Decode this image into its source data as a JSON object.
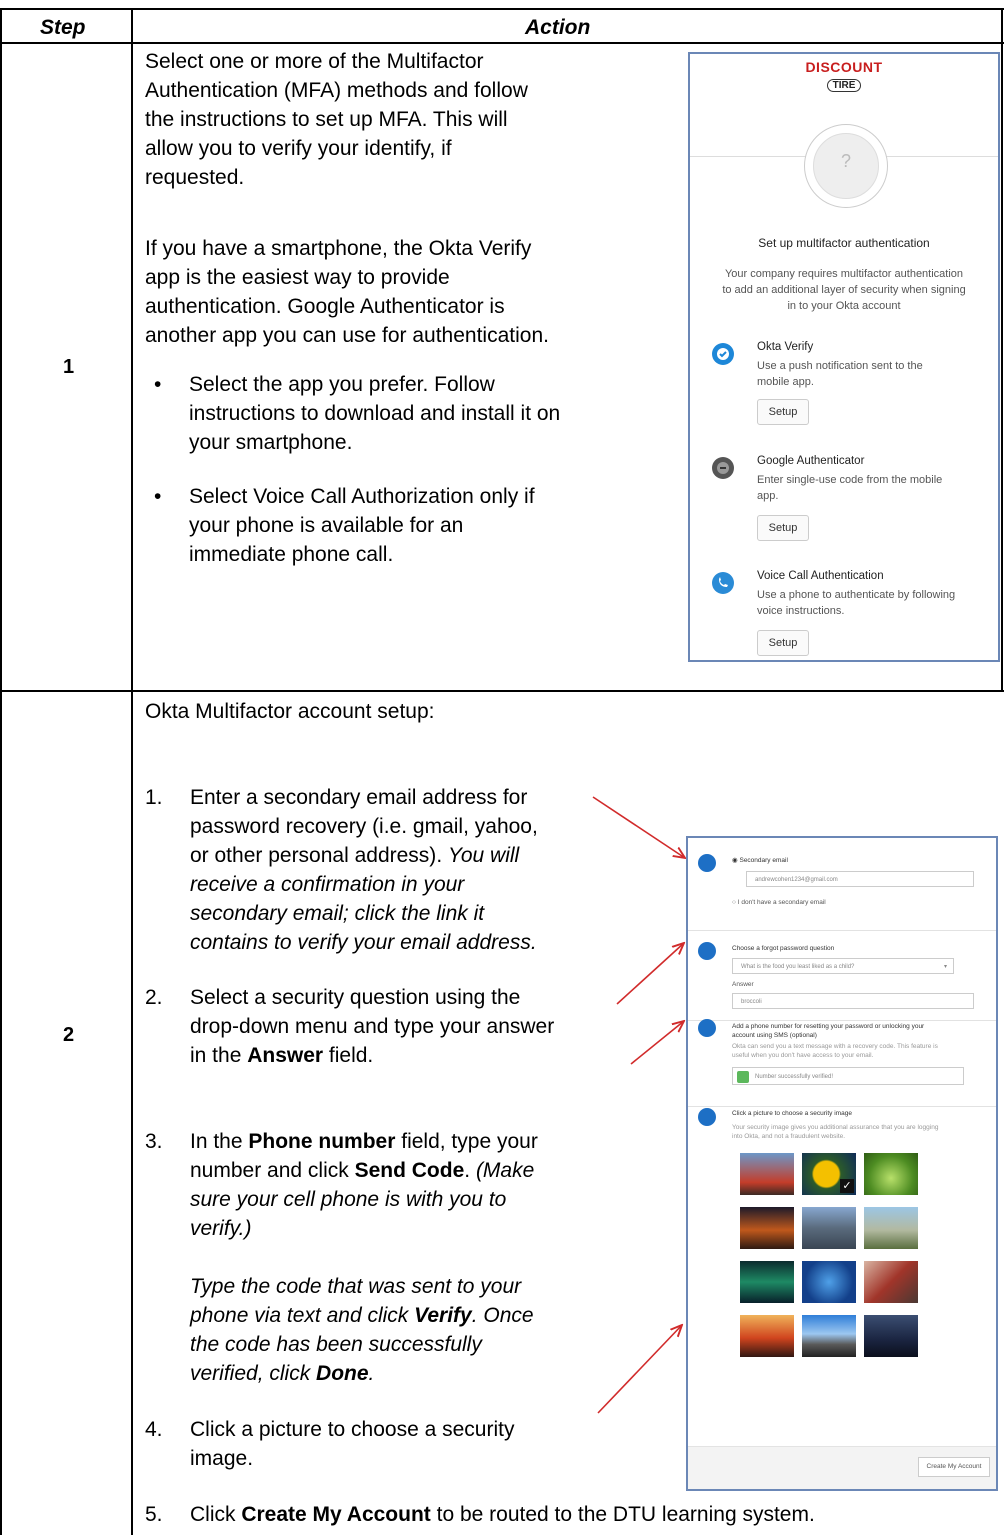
{
  "table": {
    "header": {
      "step": "Step",
      "action": "Action"
    },
    "rows": [
      {
        "step": "1",
        "para1": [
          "Select one or more of the Multifactor",
          "Authentication (MFA) methods and follow",
          "the instructions to set up MFA. This will",
          "allow you to verify your identify, if",
          "requested."
        ],
        "para2": [
          "If you have a smartphone, the Okta Verify",
          "app is the easiest way to provide",
          "authentication. Google Authenticator is",
          "another app you can use for authentication."
        ],
        "bullets": [
          [
            "Select the app you prefer. Follow",
            "instructions to download and install it on",
            "your smartphone."
          ],
          [
            "Select Voice Call Authorization only if",
            "your phone is available for an",
            "immediate phone call."
          ]
        ]
      },
      {
        "step": "2",
        "intro": "Okta Multifactor account setup:",
        "items": [
          {
            "num": "1.",
            "lines": [
              "Enter a secondary email address for",
              "password recovery (i.e. gmail, yahoo,",
              "or other personal address)"
            ],
            "tail": ". ",
            "italic_inline": "You will",
            "italic_lines": [
              "receive a confirmation in your",
              "secondary email; click the link it",
              "contains to verify your email address."
            ]
          },
          {
            "num": "2.",
            "lines": [
              "Select a security question using the",
              "drop-down menu and type your answer"
            ],
            "l3_pre": "in the ",
            "l3_bold": "Answer",
            "l3_post": " field."
          },
          {
            "num": "3.",
            "l1_pre": "In the ",
            "l1_bold": "Phone number",
            "l1_post": " field, type your",
            "l2_pre": "number and click ",
            "l2_bold": "Send Code",
            "l2_post": ". ",
            "l2_ital": "(Make",
            "ital_lines": [
              "sure your cell phone is with you to",
              "verify.)"
            ],
            "sub_l1": "Type the code that was sent to your",
            "sub_l2_pre": "phone via text and click ",
            "sub_l2_bold": "Verify",
            "sub_l2_post": ". Once",
            "sub_l3": "the code has been successfully",
            "sub_l4_pre": "verified, click ",
            "sub_l4_bold": "Done",
            "sub_l4_post": "."
          },
          {
            "num": "4.",
            "lines": [
              "Click a picture to choose a security",
              "image."
            ]
          },
          {
            "num": "5.",
            "pre": "Click ",
            "bold": "Create My Account",
            "post": " to be routed to the DTU learning system."
          }
        ]
      }
    ]
  },
  "screenshot1": {
    "logo_top": "DISCOUNT",
    "logo_bottom": "TIRE",
    "avatar_glyph": "?",
    "title": "Set up multifactor authentication",
    "desc": [
      "Your company requires multifactor authentication",
      "to add an additional layer of security when signing",
      "in to your Okta account"
    ],
    "factors": [
      {
        "name": "Okta Verify",
        "icon": "okta-verify-icon",
        "desc": [
          "Use a push notification sent to the",
          "mobile app."
        ],
        "button": "Setup"
      },
      {
        "name": "Google Authenticator",
        "icon": "google-authenticator-icon",
        "desc": [
          "Enter single-use code from the mobile",
          "app."
        ],
        "button": "Setup"
      },
      {
        "name": "Voice Call Authentication",
        "icon": "voice-call-icon",
        "desc": [
          "Use a phone to authenticate by following",
          "voice instructions."
        ],
        "button": "Setup"
      }
    ]
  },
  "screenshot2": {
    "email_radio": "Secondary email",
    "email_value": "andrewcohen1234@gmail.com",
    "no_email_radio": "I don't have a secondary email",
    "question_label": "Choose a forgot password question",
    "question_value": "What is the food you least liked as a child?",
    "answer_label": "Answer",
    "answer_value": "broccoli",
    "phone_title": [
      "Add a phone number for resetting your password or unlocking your",
      "account using SMS (optional)"
    ],
    "phone_desc": [
      "Okta can send you a text message with a recovery code. This feature is",
      "useful when you don't have access to your email."
    ],
    "phone_status": "Number successfully verified!",
    "image_title": "Click a picture to choose a security image",
    "image_desc": [
      "Your security image gives you additional assurance that you are logging",
      "into Okta, and not a fraudulent website."
    ],
    "image_selected_index": 1,
    "create_button": "Create My Account"
  },
  "colors": {
    "screenshot_border": "#6b87b6",
    "arrow": "#d12b2b",
    "okta_blue": "#1d6fc5",
    "verified_green": "#5cb85c"
  }
}
